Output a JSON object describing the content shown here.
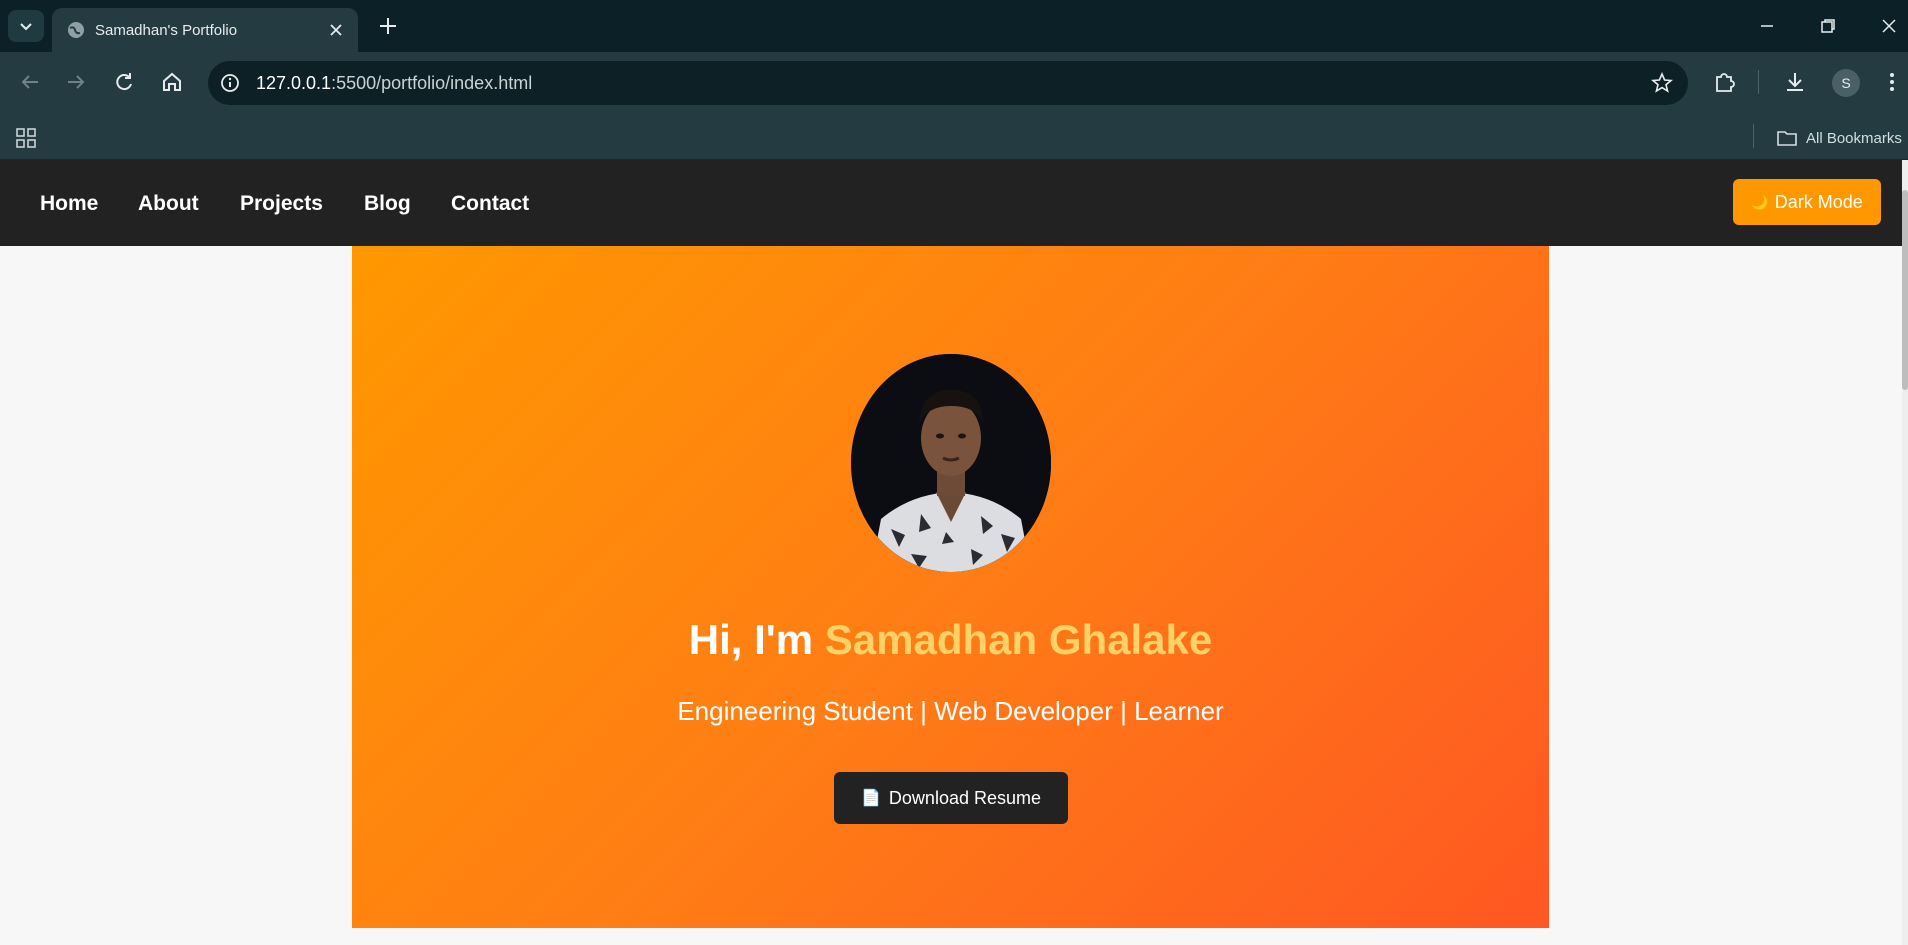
{
  "browser": {
    "tab_title": "Samadhan's Portfolio",
    "url_host": "127.0.0.1",
    "url_rest": ":5500/portfolio/index.html",
    "bookmarks_label": "All Bookmarks",
    "profile_initial": "S"
  },
  "nav": {
    "items": [
      "Home",
      "About",
      "Projects",
      "Blog",
      "Contact"
    ],
    "dark_mode_label": "Dark Mode",
    "dark_mode_icon": "🌙"
  },
  "hero": {
    "greeting": "Hi, I'm ",
    "name": "Samadhan Ghalake",
    "subtitle": "Engineering Student | Web Developer | Learner",
    "resume_label": "Download Resume",
    "resume_icon": "📄"
  },
  "colors": {
    "accent": "#ff9800",
    "gradient_end": "#ff5722",
    "name_highlight": "#ffd166",
    "nav_bg": "#222222",
    "browser_dark": "#0c2127"
  }
}
